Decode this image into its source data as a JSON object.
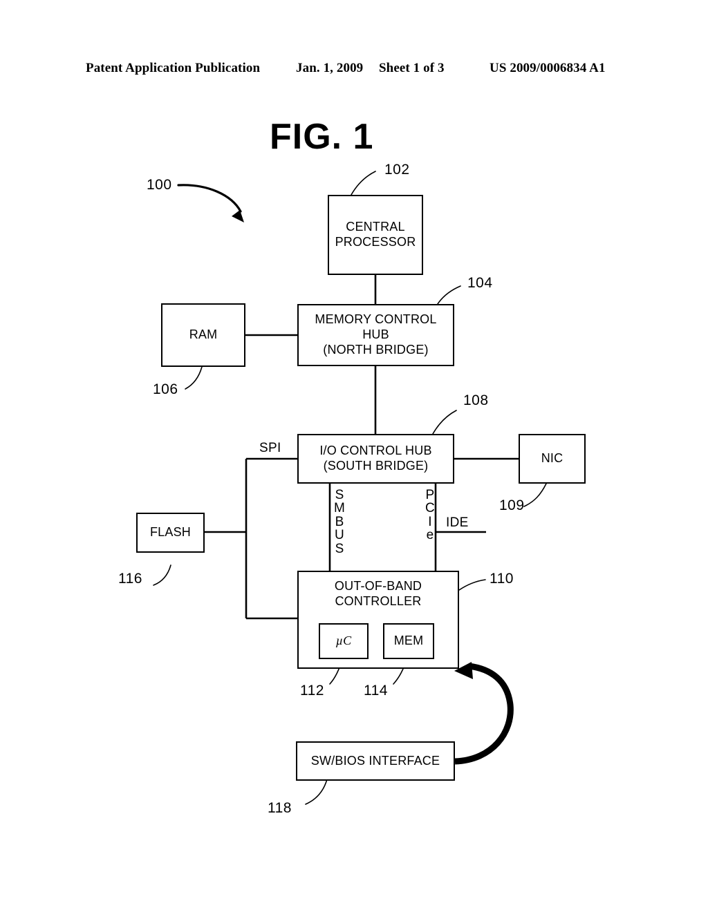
{
  "header": {
    "publication": "Patent Application Publication",
    "date": "Jan. 1, 2009",
    "sheet": "Sheet 1 of 3",
    "patent_number": "US 2009/0006834 A1"
  },
  "figure": {
    "title": "FIG. 1",
    "system_ref": "100"
  },
  "nodes": [
    {
      "id": "central-processor",
      "label": "CENTRAL\nPROCESSOR",
      "ref": "102"
    },
    {
      "id": "memory-control-hub",
      "label": "MEMORY CONTROL\nHUB\n(NORTH BRIDGE)",
      "ref": "104"
    },
    {
      "id": "ram",
      "label": "RAM",
      "ref": "106"
    },
    {
      "id": "io-control-hub",
      "label": "I/O CONTROL HUB\n(SOUTH BRIDGE)",
      "ref": "108"
    },
    {
      "id": "nic",
      "label": "NIC",
      "ref": "109"
    },
    {
      "id": "out-of-band-controller",
      "label": "OUT-OF-BAND\nCONTROLLER",
      "ref": "110"
    },
    {
      "id": "microcontroller",
      "label": "µC",
      "ref": "112"
    },
    {
      "id": "mem",
      "label": "MEM",
      "ref": "114"
    },
    {
      "id": "flash",
      "label": "FLASH",
      "ref": "116"
    },
    {
      "id": "sw-bios-interface",
      "label": "SW/BIOS INTERFACE",
      "ref": "118"
    }
  ],
  "bus_labels": {
    "spi": "SPI",
    "smbus": "SMBUS",
    "pcie": "PCIe",
    "ide": "IDE"
  },
  "colors": {
    "line": "#000000",
    "background": "#ffffff"
  }
}
